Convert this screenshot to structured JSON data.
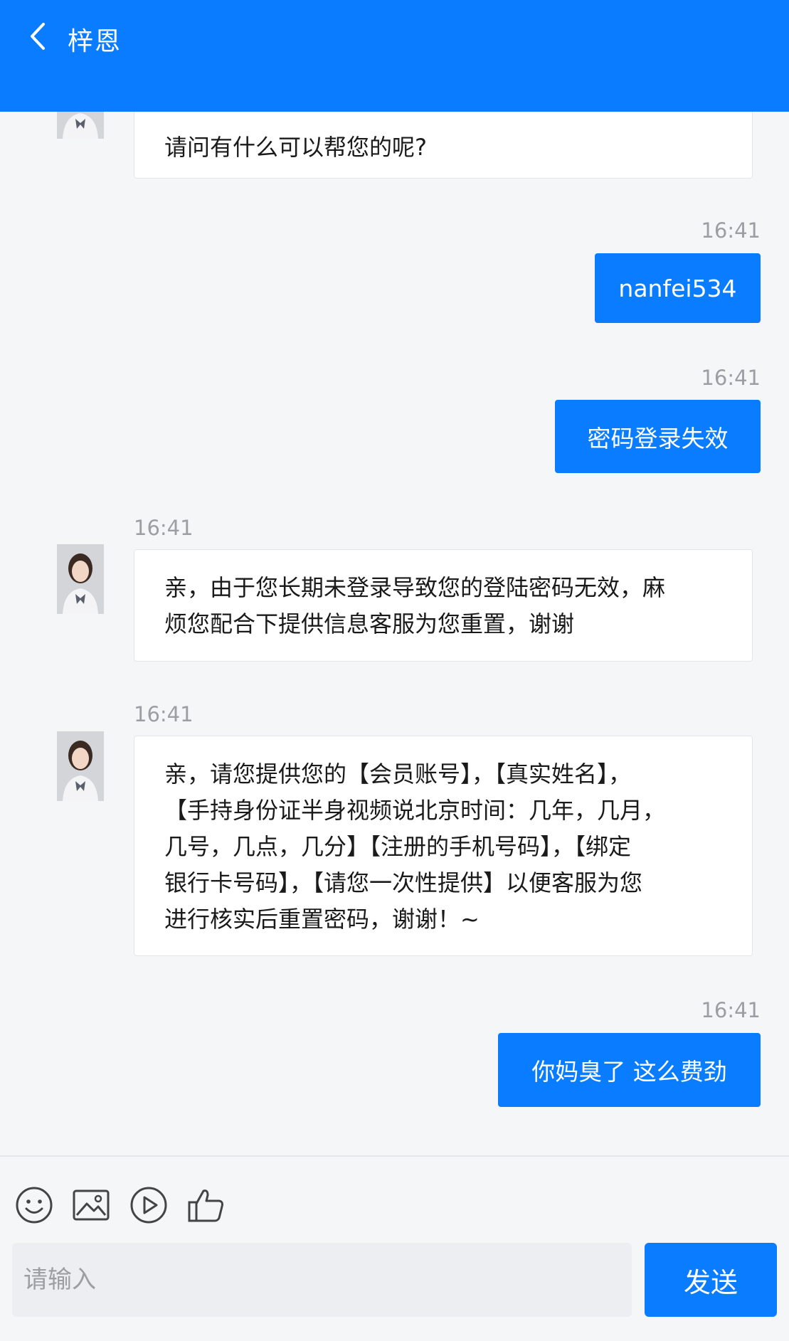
{
  "header": {
    "title": "梓恩"
  },
  "messages": {
    "m1": {
      "text": "请问有什么可以帮您的呢?"
    },
    "m2": {
      "time": "16:41",
      "text": "nanfei534"
    },
    "m3": {
      "time": "16:41",
      "text": "密码登录失效"
    },
    "m4": {
      "time": "16:41",
      "line1": "亲，由于您长期未登录导致您的登陆密码无效，麻",
      "line2": "烦您配合下提供信息客服为您重置，谢谢"
    },
    "m5": {
      "time": "16:41",
      "line1": "亲，请您提供您的【会员账号】，【真实姓名】，",
      "line2": "【手持身份证半身视频说北京时间：几年，几月，",
      "line3": "几号，几点，几分】【注册的手机号码】，【绑定",
      "line4": "银行卡号码】，【请您一次性提供】以便客服为您",
      "line5": "进行核实后重置密码，谢谢！~"
    },
    "m6": {
      "time": "16:41",
      "text": "你妈臭了 这么费劲"
    }
  },
  "toolbar": {
    "icons": [
      "emoji-icon",
      "image-icon",
      "video-icon",
      "thumbs-up-icon"
    ]
  },
  "composer": {
    "placeholder": "请输入",
    "send_label": "发送"
  },
  "colors": {
    "accent": "#0a7cff",
    "background": "#f5f6f8"
  }
}
